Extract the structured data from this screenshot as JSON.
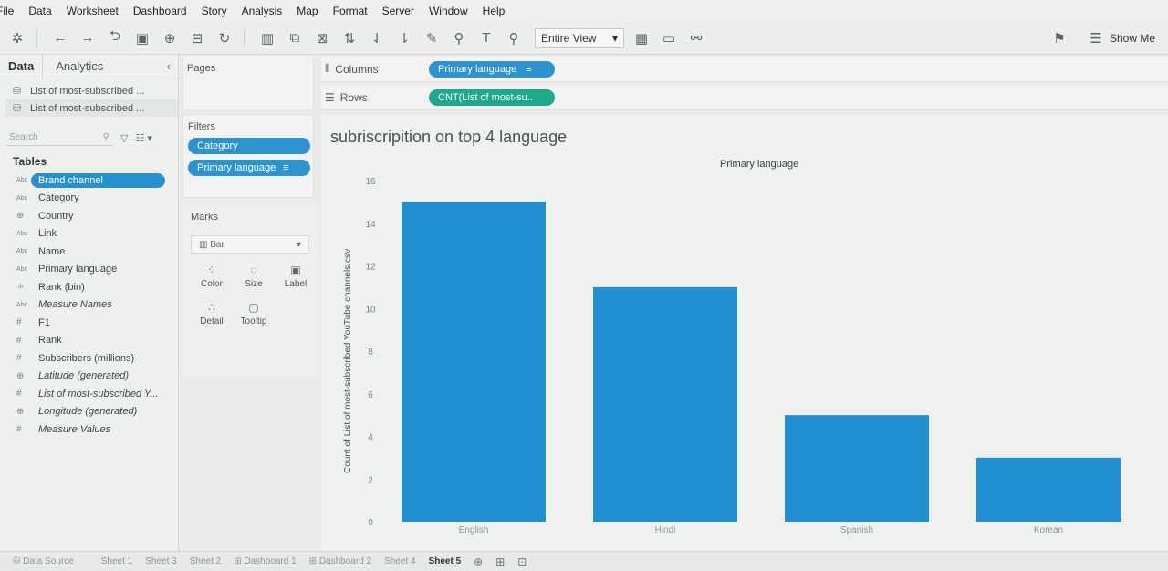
{
  "menu": [
    "File",
    "Data",
    "Worksheet",
    "Dashboard",
    "Story",
    "Analysis",
    "Map",
    "Format",
    "Server",
    "Window",
    "Help"
  ],
  "toolbar": {
    "fit_label": "Entire View",
    "show_me_label": "Show Me"
  },
  "data_pane": {
    "tab_data": "Data",
    "tab_analytics": "Analytics",
    "data_sources": [
      "List of most-subscribed ...",
      "List of most-subscribed ..."
    ],
    "search_placeholder": "Search",
    "tables_label": "Tables",
    "fields": [
      {
        "type": "Abc",
        "name": "Brand channel"
      },
      {
        "type": "Abc",
        "name": "Category"
      },
      {
        "type": "geo",
        "name": "Country"
      },
      {
        "type": "Abc",
        "name": "Link"
      },
      {
        "type": "Abc",
        "name": "Name"
      },
      {
        "type": "Abc",
        "name": "Primary language"
      },
      {
        "type": "bin",
        "name": "Rank (bin)"
      },
      {
        "type": "Abc",
        "name": "Measure Names"
      },
      {
        "type": "#",
        "name": "F1"
      },
      {
        "type": "#",
        "name": "Rank"
      },
      {
        "type": "#",
        "name": "Subscribers (millions)"
      },
      {
        "type": "geo",
        "name": "Latitude (generated)"
      },
      {
        "type": "#",
        "name": "List of most-subscribed Y..."
      },
      {
        "type": "geo",
        "name": "Longitude (generated)"
      },
      {
        "type": "#",
        "name": "Measure Values"
      }
    ]
  },
  "pages_label": "Pages",
  "filters": {
    "label": "Filters",
    "pills": [
      "Category",
      "Primary language"
    ]
  },
  "marks": {
    "label": "Marks",
    "type": "Bar",
    "buttons": [
      "Color",
      "Size",
      "Label",
      "Detail",
      "Tooltip"
    ]
  },
  "columns": {
    "label": "Columns",
    "pill": "Primary language"
  },
  "rows": {
    "label": "Rows",
    "pill": "CNT(List of most-su.."
  },
  "sheet_title": "subriscripition on top 4 language",
  "tabs": [
    "Data Source",
    "Sheet 1",
    "Sheet 3",
    "Sheet 2",
    "Dashboard 1",
    "Dashboard 2",
    "Sheet 4",
    "Sheet 5"
  ],
  "colors": {
    "bar": "#2290d0",
    "pill_blue": "#2c93cf",
    "pill_green": "#1fa88c"
  },
  "chart_data": {
    "type": "bar",
    "title": "subriscripition on top 4 language",
    "xlabel": "Primary language",
    "ylabel": "Count of List of most-subscribed YouTube channels.csv",
    "categories": [
      "English",
      "Hindi",
      "Spanish",
      "Korean"
    ],
    "values": [
      15,
      11,
      5,
      3
    ],
    "ylim": [
      0,
      16
    ],
    "yticks": [
      0,
      2,
      4,
      6,
      8,
      10,
      12,
      14,
      16
    ],
    "grid": false
  }
}
